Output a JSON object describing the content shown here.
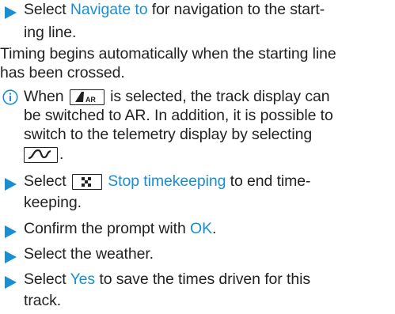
{
  "instructions": {
    "item1": {
      "prefix": "Select ",
      "link": "Navigate to",
      "suffix": " for navigation to the start-",
      "cont": "ing line."
    },
    "para": {
      "line1": "Timing begins automatically when the starting line",
      "line2": "has been crossed."
    },
    "info": {
      "icon": "info-icon",
      "line1_prefix": "When ",
      "line1_suffix": " is selected, the track display can",
      "line2": "be switched to AR. In addition, it is possible to",
      "line3": "switch to the telemetry display by selecting",
      "line4_suffix": ".",
      "ar_icon_label": "AR",
      "ar_icon": "ar-track-icon",
      "telemetry_icon": "telemetry-icon"
    },
    "item2": {
      "prefix": "Select ",
      "link": "Stop timekeeping",
      "suffix": " to end time-",
      "cont": "keeping.",
      "icon": "flag-icon"
    },
    "item3": {
      "prefix": "Confirm the prompt with ",
      "link": "OK",
      "suffix": "."
    },
    "item4": {
      "text": "Select the weather."
    },
    "item5": {
      "prefix": "Select ",
      "link": "Yes",
      "suffix": " to save the times driven for this",
      "cont": "track."
    }
  },
  "colors": {
    "accent": "#1a8fcf",
    "text": "#222222"
  }
}
